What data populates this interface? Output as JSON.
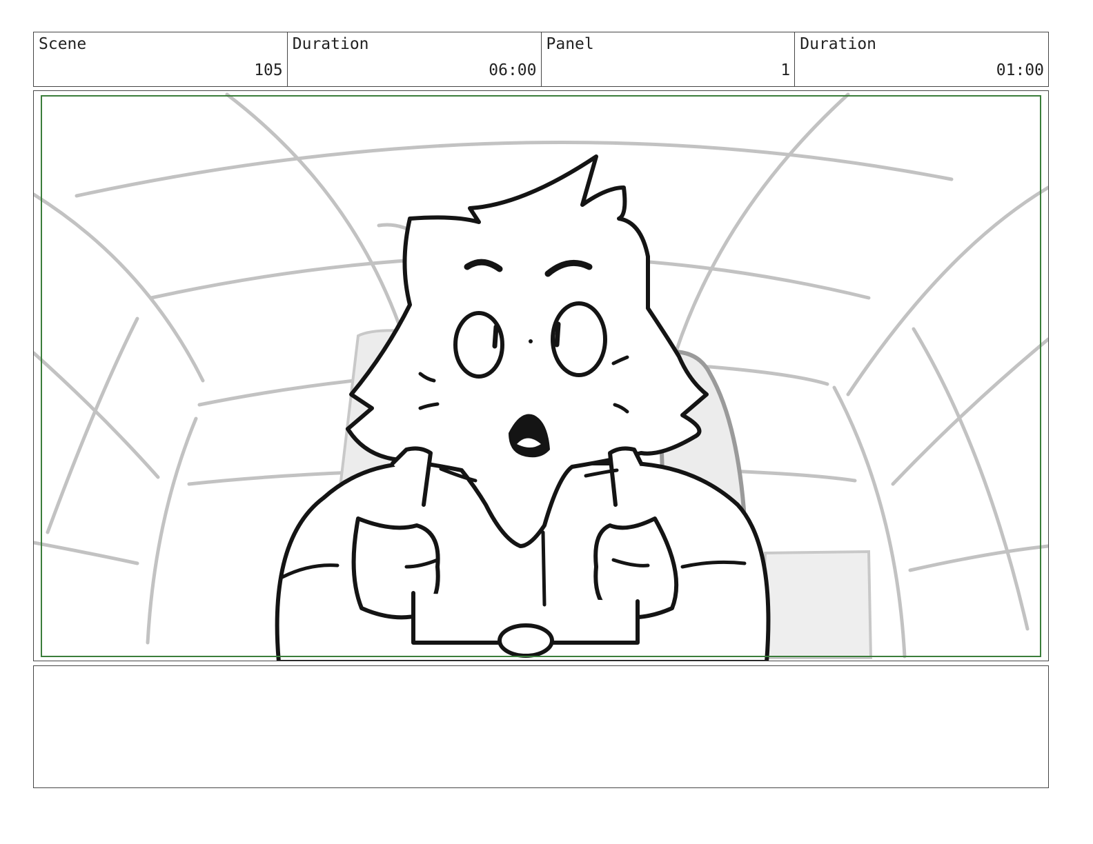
{
  "header": {
    "scene_label": "Scene",
    "scene_value": "105",
    "scene_duration_label": "Duration",
    "scene_duration_value": "06:00",
    "panel_label": "Panel",
    "panel_value": "1",
    "panel_duration_label": "Duration",
    "panel_duration_value": "01:00"
  },
  "notes": {
    "text": ""
  },
  "colors": {
    "safe_area": "#3a7d3a",
    "sketch_gray": "#bdbdbd",
    "ink": "#141414"
  }
}
